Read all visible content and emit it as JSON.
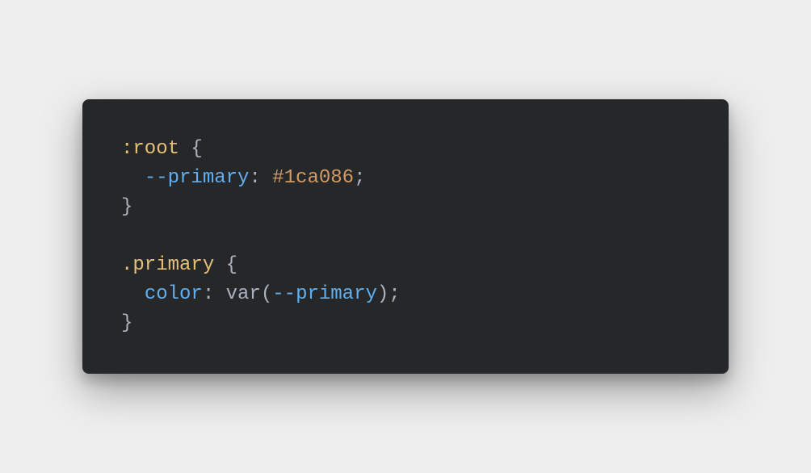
{
  "code": {
    "line1": {
      "pseudo": ":root",
      "space": " ",
      "brace_open": "{"
    },
    "line2": {
      "indent": "  ",
      "property": "--primary",
      "colon": ":",
      "space": " ",
      "value": "#1ca086",
      "semicolon": ";"
    },
    "line3": {
      "brace_close": "}"
    },
    "line5": {
      "selector": ".primary",
      "space": " ",
      "brace_open": "{"
    },
    "line6": {
      "indent": "  ",
      "property": "color",
      "colon": ":",
      "space": " ",
      "fn": "var",
      "paren_open": "(",
      "var": "--primary",
      "paren_close": ")",
      "semicolon": ";"
    },
    "line7": {
      "brace_close": "}"
    }
  }
}
